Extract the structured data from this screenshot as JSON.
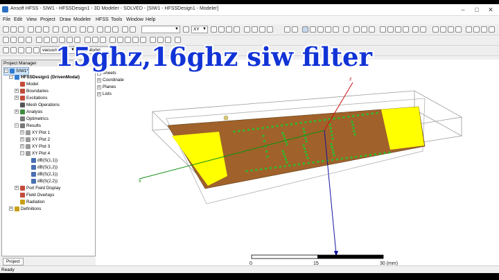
{
  "window": {
    "title": "Ansoft HFSS - SIW1 - HFSSDesign1 - 3D Modeler - SOLVED - [SIW1 - HFSSDesign1 - Modeler]",
    "minimize": "–",
    "maximize": "□",
    "close": "✕"
  },
  "menu": [
    "File",
    "Edit",
    "View",
    "Project",
    "Draw",
    "Modeler",
    "HFSS",
    "Tools",
    "Window",
    "Help"
  ],
  "toolbar": {
    "plane_value": "XY",
    "material_value": "vacuum",
    "model_value": "Model"
  },
  "project_manager": {
    "title": "Project Manager",
    "tab": "Project",
    "tree": [
      {
        "label": "SIW1*",
        "depth": 0,
        "expander": "−",
        "icon": "project-icon",
        "color": "#2f7bd1",
        "selected": true
      },
      {
        "label": "HFSSDesign1 (DrivenModal)",
        "depth": 1,
        "expander": "−",
        "icon": "design-icon",
        "color": "#2f7bd1",
        "bold": true
      },
      {
        "label": "Model",
        "depth": 2,
        "expander": "",
        "icon": "model-icon",
        "color": "#c24b3a"
      },
      {
        "label": "Boundaries",
        "depth": 2,
        "expander": "+",
        "icon": "boundaries-icon",
        "color": "#c24b3a"
      },
      {
        "label": "Excitations",
        "depth": 2,
        "expander": "+",
        "icon": "excitations-icon",
        "color": "#c24b3a"
      },
      {
        "label": "Mesh Operations",
        "depth": 2,
        "expander": "",
        "icon": "mesh-icon",
        "color": "#555555"
      },
      {
        "label": "Analysis",
        "depth": 2,
        "expander": "+",
        "icon": "analysis-icon",
        "color": "#3c8c3c"
      },
      {
        "label": "Optimetrics",
        "depth": 2,
        "expander": "",
        "icon": "optimetrics-icon",
        "color": "#777777"
      },
      {
        "label": "Results",
        "depth": 2,
        "expander": "−",
        "icon": "results-icon",
        "color": "#777777"
      },
      {
        "label": "XY Plot 1",
        "depth": 3,
        "expander": "+",
        "icon": "plot-icon",
        "color": "#999999"
      },
      {
        "label": "XY Plot 2",
        "depth": 3,
        "expander": "+",
        "icon": "plot-icon",
        "color": "#999999"
      },
      {
        "label": "XY Plot 3",
        "depth": 3,
        "expander": "+",
        "icon": "plot-icon",
        "color": "#999999"
      },
      {
        "label": "XY Plot 4",
        "depth": 3,
        "expander": "−",
        "icon": "plot-icon",
        "color": "#999999"
      },
      {
        "label": "dB(S(1,1))",
        "depth": 4,
        "expander": "",
        "icon": "trace-icon",
        "color": "#4a6fb3"
      },
      {
        "label": "dB(S(1,2))",
        "depth": 4,
        "expander": "",
        "icon": "trace-icon",
        "color": "#4a6fb3"
      },
      {
        "label": "dB(S(2,1))",
        "depth": 4,
        "expander": "",
        "icon": "trace-icon",
        "color": "#4a6fb3"
      },
      {
        "label": "dB(S(2,2))",
        "depth": 4,
        "expander": "",
        "icon": "trace-icon",
        "color": "#4a6fb3"
      },
      {
        "label": "Port Field Display",
        "depth": 2,
        "expander": "+",
        "icon": "port-field-icon",
        "color": "#c24b3a"
      },
      {
        "label": "Field Overlays",
        "depth": 2,
        "expander": "",
        "icon": "field-overlays-icon",
        "color": "#c24b3a"
      },
      {
        "label": "Radiation",
        "depth": 2,
        "expander": "",
        "icon": "radiation-icon",
        "color": "#c8a018"
      },
      {
        "label": "Definitions",
        "depth": 1,
        "expander": "+",
        "icon": "definitions-icon",
        "color": "#c8a018"
      }
    ]
  },
  "model_tree": [
    {
      "label": "Sheets",
      "expander": "+"
    },
    {
      "label": "Coordinate",
      "expander": "+"
    },
    {
      "label": "Planes",
      "expander": "+"
    },
    {
      "label": "Lists",
      "expander": "+"
    }
  ],
  "overlay_title": "15ghz,16ghz siw filter",
  "canvas": {
    "axis_x": "x",
    "axis_z": "z",
    "scale_labels": [
      "0",
      "15",
      "30 (mm)"
    ],
    "colors": {
      "substrate": "#a0622a",
      "pads": "#ffff00",
      "vias": "#2dbb2d",
      "axis_z": "#c81010",
      "axis_y": "#1010a0",
      "axis_x": "#109010"
    }
  },
  "status": "Ready"
}
